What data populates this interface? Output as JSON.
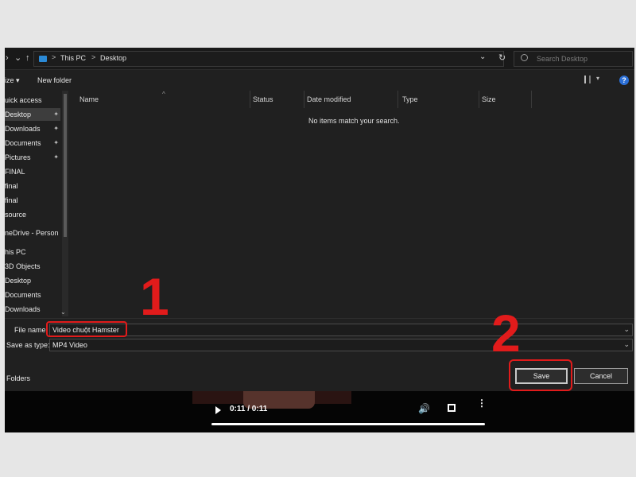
{
  "nav_buttons": {
    "forward": "›",
    "dropdown": "⌄",
    "up": "↑"
  },
  "address": {
    "crumbs": [
      "This PC",
      "Desktop"
    ],
    "sep": ">",
    "dropdown_glyph": "⌄",
    "refresh_glyph": "↻"
  },
  "search": {
    "placeholder": "Search Desktop"
  },
  "toolbar": {
    "organize_label": "ize ▾",
    "new_folder_label": "New folder",
    "view_dropdown_glyph": "▾",
    "help_glyph": "?"
  },
  "sidebar": {
    "items": [
      {
        "label": "uick access",
        "pinned": false
      },
      {
        "label": "Desktop",
        "pinned": true
      },
      {
        "label": "Downloads",
        "pinned": true
      },
      {
        "label": "Documents",
        "pinned": true
      },
      {
        "label": "Pictures",
        "pinned": true
      },
      {
        "label": "FINAL",
        "pinned": false
      },
      {
        "label": "final",
        "pinned": false
      },
      {
        "label": "final",
        "pinned": false
      },
      {
        "label": "source",
        "pinned": false
      },
      {
        "label": "neDrive - Person",
        "pinned": false
      },
      {
        "label": "his PC",
        "pinned": false
      },
      {
        "label": "3D Objects",
        "pinned": false
      },
      {
        "label": "Desktop",
        "pinned": false
      },
      {
        "label": "Documents",
        "pinned": false
      },
      {
        "label": "Downloads",
        "pinned": false
      }
    ],
    "pin_glyph": "📌",
    "scroll_down_glyph": "⌄"
  },
  "columns": [
    "Name",
    "Status",
    "Date modified",
    "Type",
    "Size"
  ],
  "sort_glyph": "^",
  "empty_message": "No items match your search.",
  "form": {
    "file_name_label": "File name:",
    "file_name_value": "Video chuột Hamster",
    "save_type_label": "Save as type:",
    "save_type_value": "MP4 Video",
    "dropdown_glyph": "⌄",
    "folders_label": "Folders",
    "save_button": "Save",
    "cancel_button": "Cancel"
  },
  "annotations": {
    "step1": "1",
    "step2": "2",
    "color": "#e11b1b"
  },
  "player": {
    "time": "0:11 / 0:11",
    "progress": 1.0,
    "volume_glyph": "🔊",
    "more_glyph": "⋮"
  }
}
